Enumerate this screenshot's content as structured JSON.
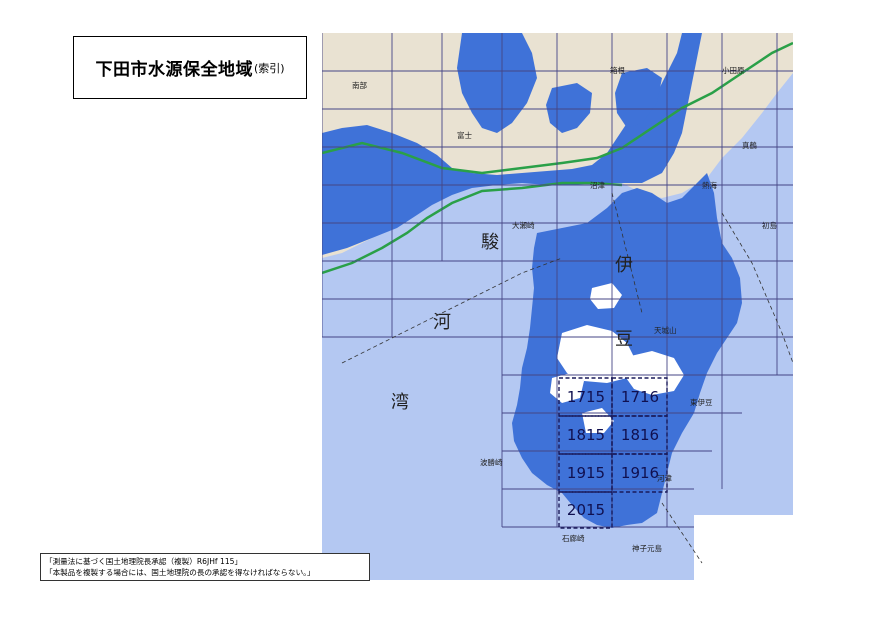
{
  "title": {
    "main": "下田市水源保全地域",
    "sub": "(索引)"
  },
  "credit": {
    "line1": "「測量法に基づく国土地理院長承認（複製）R6JHf 115」",
    "line2": "「本製品を複製する場合には、国土地理院の長の承認を得なければならない。」"
  },
  "map": {
    "labels": {
      "suruga_1": "駿",
      "suruga_2": "河",
      "suruga_3": "湾",
      "izu_1": "伊",
      "izu_2": "豆",
      "hakone": "箱根",
      "atami": "熱海",
      "numazu": "沼津",
      "fuji": "富士",
      "oseza": "大瀬崎",
      "hatsushima": "初島",
      "amagi": "天城山",
      "higashiizu": "東伊豆",
      "nanbu": "南部",
      "hatenami": "波勝崎",
      "irozaki": "石廊崎",
      "kawazu": "河津",
      "mikomoto": "神子元島",
      "manazuru": "真鶴",
      "odawara": "小田原"
    },
    "index_sheets": [
      {
        "id": "1715"
      },
      {
        "id": "1716"
      },
      {
        "id": "1815"
      },
      {
        "id": "1816"
      },
      {
        "id": "1915"
      },
      {
        "id": "1916"
      },
      {
        "id": "2015"
      }
    ],
    "colors": {
      "sea": "#b4c8f2",
      "land_north": "#e8e0d0",
      "watershed": "#3f72d8",
      "white_area": "#ffffff",
      "grid": "#454585",
      "road": "#2aa048"
    }
  }
}
